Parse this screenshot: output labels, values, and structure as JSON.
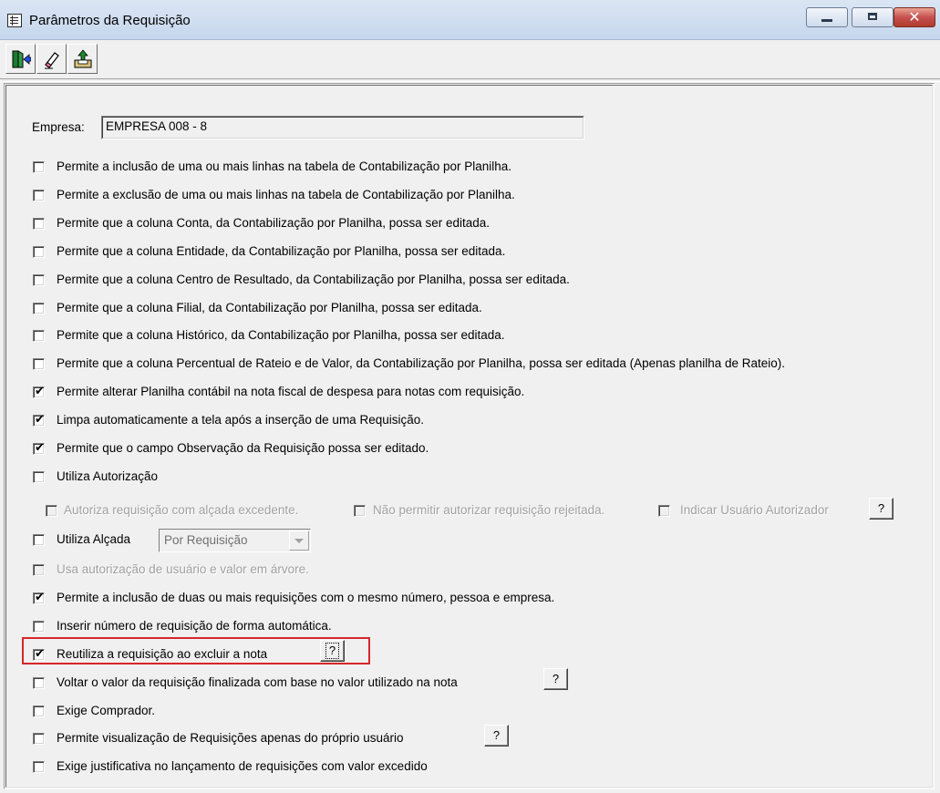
{
  "window": {
    "title": "Parâmetros da Requisição",
    "close_glyph": "✕"
  },
  "toolbar": {
    "buttons": [
      {
        "icon": "exit-door-icon"
      },
      {
        "icon": "eraser-icon"
      },
      {
        "icon": "save-tray-icon"
      }
    ]
  },
  "empresa": {
    "label": "Empresa:",
    "value": "EMPRESA 008 - 8"
  },
  "options": [
    {
      "label": "Permite a inclusão de uma ou mais linhas na tabela de Contabilização por Planilha.",
      "checked": false
    },
    {
      "label": "Permite a exclusão de uma ou mais linhas na tabela de Contabilização por Planilha.",
      "checked": false
    },
    {
      "label": "Permite que a coluna Conta, da Contabilização por Planilha, possa ser editada.",
      "checked": false
    },
    {
      "label": "Permite que a coluna Entidade, da Contabilização por Planilha, possa ser editada.",
      "checked": false
    },
    {
      "label": "Permite que a coluna Centro de Resultado, da Contabilização por Planilha, possa ser editada.",
      "checked": false
    },
    {
      "label": "Permite que a coluna Filial, da Contabilização por Planilha, possa ser editada.",
      "checked": false
    },
    {
      "label": "Permite que a coluna Histórico, da Contabilização por Planilha, possa ser editada.",
      "checked": false
    },
    {
      "label": "Permite que a coluna Percentual de Rateio e de Valor, da Contabilização por Planilha, possa ser editada (Apenas planilha de Rateio).",
      "checked": false
    },
    {
      "label": "Permite alterar Planilha contábil na nota fiscal de despesa para notas com requisição.",
      "checked": true
    },
    {
      "label": "Limpa automaticamente a tela após a inserção de uma Requisição.",
      "checked": true
    },
    {
      "label": "Permite que o campo Observação da Requisição possa ser editado.",
      "checked": true
    },
    {
      "label": "Utiliza Autorização",
      "checked": false
    }
  ],
  "autorizacao_sub": [
    {
      "label": "Autoriza requisição com alçada excedente.",
      "checked": false,
      "disabled": true
    },
    {
      "label": "Não permitir autorizar requisição rejeitada.",
      "checked": false,
      "disabled": true
    },
    {
      "label": "Indicar Usuário Autorizador",
      "checked": false,
      "disabled": true
    }
  ],
  "alcada": {
    "label": "Utiliza Alçada",
    "checked": false,
    "select_value": "Por Requisição"
  },
  "options2": [
    {
      "label": "Usa autorização de usuário e valor em árvore.",
      "checked": false,
      "disabled": true
    },
    {
      "label": "Permite a inclusão de duas ou mais requisições com o mesmo número, pessoa e empresa.",
      "checked": true
    },
    {
      "label": "Inserir número de requisição de forma automática.",
      "checked": false
    },
    {
      "label": "Reutiliza a requisição ao excluir a nota",
      "checked": true
    },
    {
      "label": "Voltar o valor da requisição finalizada com base no valor utilizado na nota",
      "checked": false
    },
    {
      "label": "Exige Comprador.",
      "checked": false
    },
    {
      "label": "Permite visualização de Requisições apenas do próprio usuário",
      "checked": false
    },
    {
      "label": "Exige justificativa no lançamento de requisições com valor excedido",
      "checked": false
    }
  ],
  "help_label": "?",
  "check_glyph": "✔",
  "highlight_color": "#d6262b"
}
